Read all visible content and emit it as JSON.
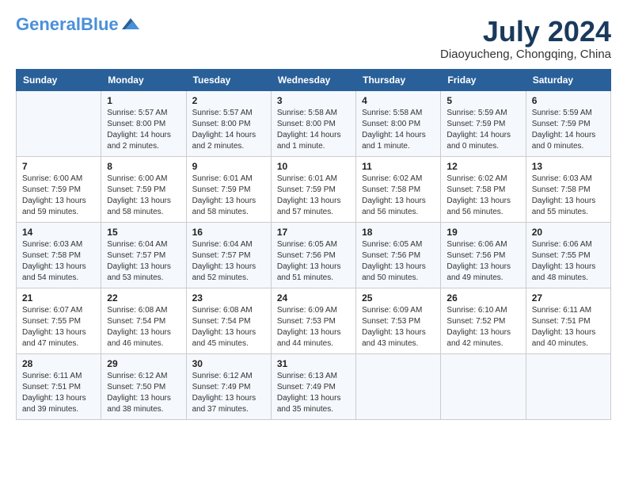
{
  "header": {
    "logo_general": "General",
    "logo_blue": "Blue",
    "month_year": "July 2024",
    "location": "Diaoyucheng, Chongqing, China"
  },
  "weekdays": [
    "Sunday",
    "Monday",
    "Tuesday",
    "Wednesday",
    "Thursday",
    "Friday",
    "Saturday"
  ],
  "weeks": [
    [
      {
        "day": "",
        "info": ""
      },
      {
        "day": "1",
        "info": "Sunrise: 5:57 AM\nSunset: 8:00 PM\nDaylight: 14 hours\nand 2 minutes."
      },
      {
        "day": "2",
        "info": "Sunrise: 5:57 AM\nSunset: 8:00 PM\nDaylight: 14 hours\nand 2 minutes."
      },
      {
        "day": "3",
        "info": "Sunrise: 5:58 AM\nSunset: 8:00 PM\nDaylight: 14 hours\nand 1 minute."
      },
      {
        "day": "4",
        "info": "Sunrise: 5:58 AM\nSunset: 8:00 PM\nDaylight: 14 hours\nand 1 minute."
      },
      {
        "day": "5",
        "info": "Sunrise: 5:59 AM\nSunset: 7:59 PM\nDaylight: 14 hours\nand 0 minutes."
      },
      {
        "day": "6",
        "info": "Sunrise: 5:59 AM\nSunset: 7:59 PM\nDaylight: 14 hours\nand 0 minutes."
      }
    ],
    [
      {
        "day": "7",
        "info": "Sunrise: 6:00 AM\nSunset: 7:59 PM\nDaylight: 13 hours\nand 59 minutes."
      },
      {
        "day": "8",
        "info": "Sunrise: 6:00 AM\nSunset: 7:59 PM\nDaylight: 13 hours\nand 58 minutes."
      },
      {
        "day": "9",
        "info": "Sunrise: 6:01 AM\nSunset: 7:59 PM\nDaylight: 13 hours\nand 58 minutes."
      },
      {
        "day": "10",
        "info": "Sunrise: 6:01 AM\nSunset: 7:59 PM\nDaylight: 13 hours\nand 57 minutes."
      },
      {
        "day": "11",
        "info": "Sunrise: 6:02 AM\nSunset: 7:58 PM\nDaylight: 13 hours\nand 56 minutes."
      },
      {
        "day": "12",
        "info": "Sunrise: 6:02 AM\nSunset: 7:58 PM\nDaylight: 13 hours\nand 56 minutes."
      },
      {
        "day": "13",
        "info": "Sunrise: 6:03 AM\nSunset: 7:58 PM\nDaylight: 13 hours\nand 55 minutes."
      }
    ],
    [
      {
        "day": "14",
        "info": "Sunrise: 6:03 AM\nSunset: 7:58 PM\nDaylight: 13 hours\nand 54 minutes."
      },
      {
        "day": "15",
        "info": "Sunrise: 6:04 AM\nSunset: 7:57 PM\nDaylight: 13 hours\nand 53 minutes."
      },
      {
        "day": "16",
        "info": "Sunrise: 6:04 AM\nSunset: 7:57 PM\nDaylight: 13 hours\nand 52 minutes."
      },
      {
        "day": "17",
        "info": "Sunrise: 6:05 AM\nSunset: 7:56 PM\nDaylight: 13 hours\nand 51 minutes."
      },
      {
        "day": "18",
        "info": "Sunrise: 6:05 AM\nSunset: 7:56 PM\nDaylight: 13 hours\nand 50 minutes."
      },
      {
        "day": "19",
        "info": "Sunrise: 6:06 AM\nSunset: 7:56 PM\nDaylight: 13 hours\nand 49 minutes."
      },
      {
        "day": "20",
        "info": "Sunrise: 6:06 AM\nSunset: 7:55 PM\nDaylight: 13 hours\nand 48 minutes."
      }
    ],
    [
      {
        "day": "21",
        "info": "Sunrise: 6:07 AM\nSunset: 7:55 PM\nDaylight: 13 hours\nand 47 minutes."
      },
      {
        "day": "22",
        "info": "Sunrise: 6:08 AM\nSunset: 7:54 PM\nDaylight: 13 hours\nand 46 minutes."
      },
      {
        "day": "23",
        "info": "Sunrise: 6:08 AM\nSunset: 7:54 PM\nDaylight: 13 hours\nand 45 minutes."
      },
      {
        "day": "24",
        "info": "Sunrise: 6:09 AM\nSunset: 7:53 PM\nDaylight: 13 hours\nand 44 minutes."
      },
      {
        "day": "25",
        "info": "Sunrise: 6:09 AM\nSunset: 7:53 PM\nDaylight: 13 hours\nand 43 minutes."
      },
      {
        "day": "26",
        "info": "Sunrise: 6:10 AM\nSunset: 7:52 PM\nDaylight: 13 hours\nand 42 minutes."
      },
      {
        "day": "27",
        "info": "Sunrise: 6:11 AM\nSunset: 7:51 PM\nDaylight: 13 hours\nand 40 minutes."
      }
    ],
    [
      {
        "day": "28",
        "info": "Sunrise: 6:11 AM\nSunset: 7:51 PM\nDaylight: 13 hours\nand 39 minutes."
      },
      {
        "day": "29",
        "info": "Sunrise: 6:12 AM\nSunset: 7:50 PM\nDaylight: 13 hours\nand 38 minutes."
      },
      {
        "day": "30",
        "info": "Sunrise: 6:12 AM\nSunset: 7:49 PM\nDaylight: 13 hours\nand 37 minutes."
      },
      {
        "day": "31",
        "info": "Sunrise: 6:13 AM\nSunset: 7:49 PM\nDaylight: 13 hours\nand 35 minutes."
      },
      {
        "day": "",
        "info": ""
      },
      {
        "day": "",
        "info": ""
      },
      {
        "day": "",
        "info": ""
      }
    ]
  ]
}
